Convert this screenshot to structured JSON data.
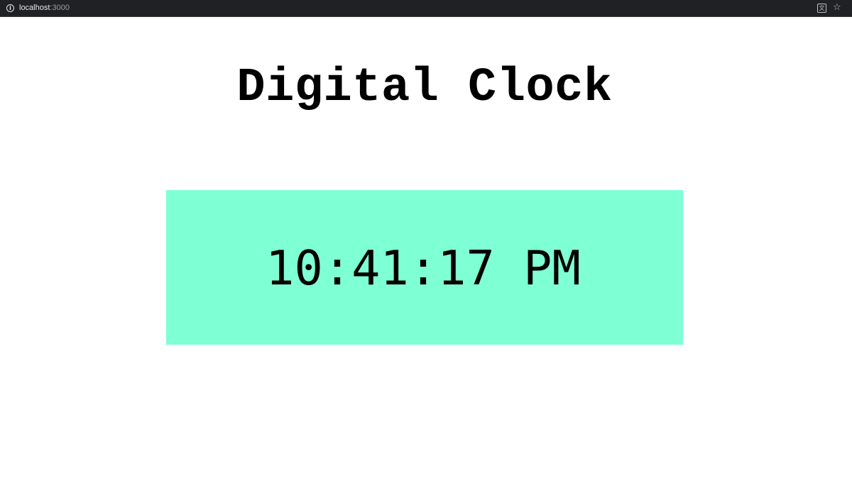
{
  "browser": {
    "url_host": "localhost",
    "url_port": ":3000",
    "icons": [
      "info-icon",
      "translate-icon",
      "star-icon"
    ]
  },
  "page": {
    "title": "Digital Clock",
    "time": "10:41:17 PM"
  },
  "colors": {
    "clock_background": "#7fffd4",
    "page_background": "#ffffff",
    "text": "#000000"
  }
}
